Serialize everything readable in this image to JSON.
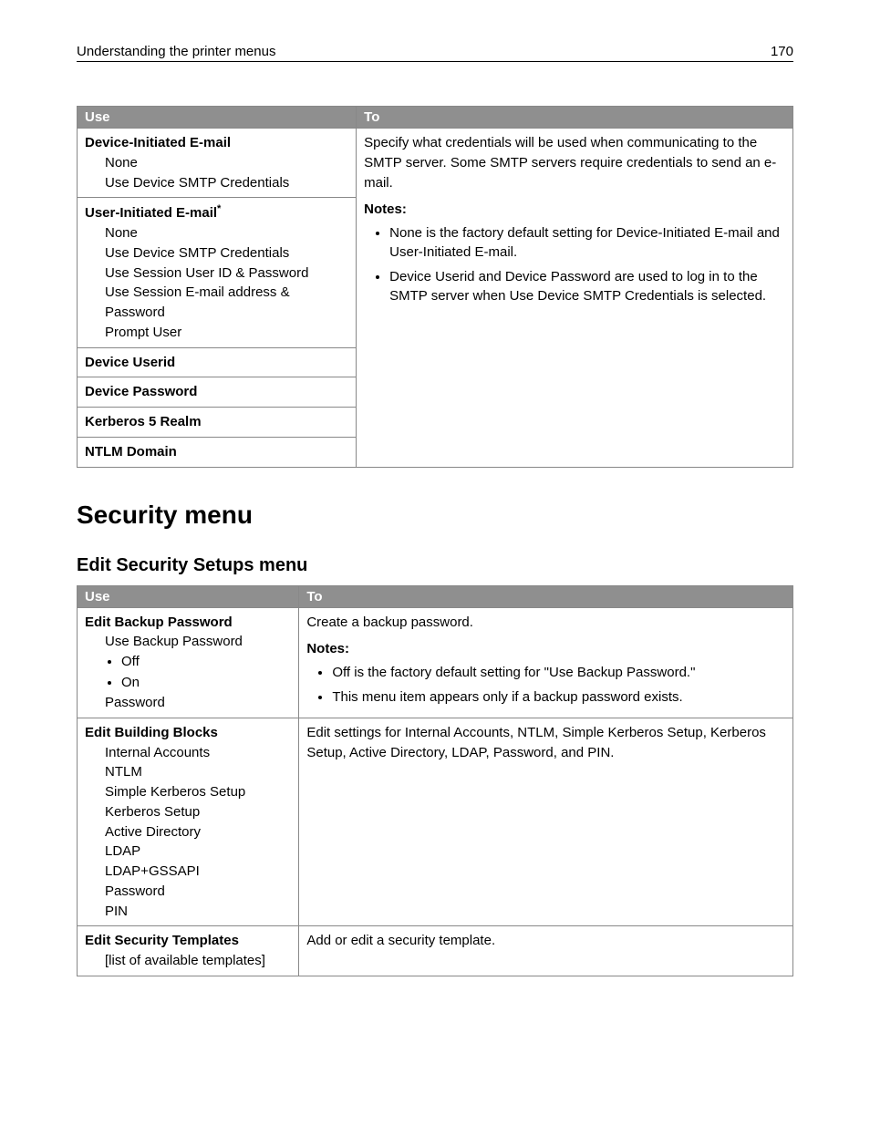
{
  "header": {
    "title": "Understanding the printer menus",
    "page": "170"
  },
  "table1": {
    "head": {
      "use": "Use",
      "to": "To"
    },
    "deviceInit": {
      "title": "Device-Initiated E-mail",
      "opts": [
        "None",
        "Use Device SMTP Credentials"
      ]
    },
    "userInit": {
      "title": "User-Initiated E-mail",
      "star": "*",
      "opts": [
        "None",
        "Use Device SMTP Credentials",
        "Use Session User ID & Password",
        "Use Session E-mail address & Password",
        "Prompt User"
      ]
    },
    "rows": [
      "Device Userid",
      "Device Password",
      "Kerberos 5 Realm",
      "NTLM Domain"
    ],
    "to": {
      "p1": "Specify what credentials will be used when communicating to the SMTP server. Some SMTP servers require credentials to send an e-mail.",
      "notesLabel": "Notes:",
      "notes": [
        "None is the factory default setting for Device-Initiated E-mail and User-Initiated E-mail.",
        "Device Userid and Device Password are used to log in to the SMTP server when Use Device SMTP Credentials is selected."
      ]
    }
  },
  "section": {
    "h1": "Security menu",
    "h2": "Edit Security Setups menu"
  },
  "table2": {
    "head": {
      "use": "Use",
      "to": "To"
    },
    "r1": {
      "title": "Edit Backup Password",
      "sub1": "Use Backup Password",
      "bullets": [
        "Off",
        "On"
      ],
      "sub2": "Password",
      "to_p": "Create a backup password.",
      "notesLabel": "Notes:",
      "notes": [
        "Off is the factory default setting for \"Use Backup Password.\"",
        "This menu item appears only if a backup password exists."
      ]
    },
    "r2": {
      "title": "Edit Building Blocks",
      "opts": [
        "Internal Accounts",
        "NTLM",
        "Simple Kerberos Setup",
        "Kerberos Setup",
        "Active Directory",
        "LDAP",
        "LDAP+GSSAPI",
        "Password",
        "PIN"
      ],
      "to": "Edit settings for Internal Accounts, NTLM, Simple Kerberos Setup, Kerberos Setup, Active Directory, LDAP, Password, and PIN."
    },
    "r3": {
      "title": "Edit Security Templates",
      "sub": "[list of available templates]",
      "to": "Add or edit a security template."
    }
  }
}
